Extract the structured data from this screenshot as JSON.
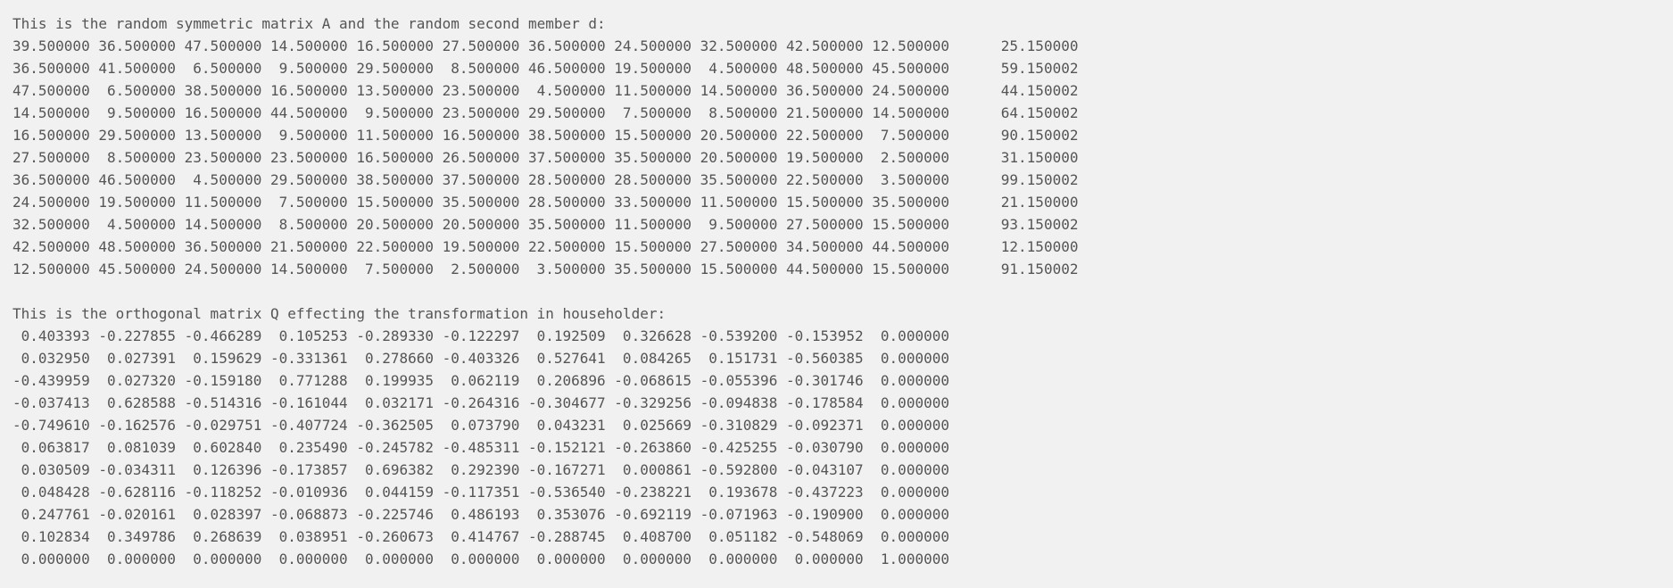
{
  "console": {
    "lines": [
      "This is the random symmetric matrix A and the random second member d:",
      "39.500000 36.500000 47.500000 14.500000 16.500000 27.500000 36.500000 24.500000 32.500000 42.500000 12.500000      25.150000",
      "36.500000 41.500000  6.500000  9.500000 29.500000  8.500000 46.500000 19.500000  4.500000 48.500000 45.500000      59.150002",
      "47.500000  6.500000 38.500000 16.500000 13.500000 23.500000  4.500000 11.500000 14.500000 36.500000 24.500000      44.150002",
      "14.500000  9.500000 16.500000 44.500000  9.500000 23.500000 29.500000  7.500000  8.500000 21.500000 14.500000      64.150002",
      "16.500000 29.500000 13.500000  9.500000 11.500000 16.500000 38.500000 15.500000 20.500000 22.500000  7.500000      90.150002",
      "27.500000  8.500000 23.500000 23.500000 16.500000 26.500000 37.500000 35.500000 20.500000 19.500000  2.500000      31.150000",
      "36.500000 46.500000  4.500000 29.500000 38.500000 37.500000 28.500000 28.500000 35.500000 22.500000  3.500000      99.150002",
      "24.500000 19.500000 11.500000  7.500000 15.500000 35.500000 28.500000 33.500000 11.500000 15.500000 35.500000      21.150000",
      "32.500000  4.500000 14.500000  8.500000 20.500000 20.500000 35.500000 11.500000  9.500000 27.500000 15.500000      93.150002",
      "42.500000 48.500000 36.500000 21.500000 22.500000 19.500000 22.500000 15.500000 27.500000 34.500000 44.500000      12.150000",
      "12.500000 45.500000 24.500000 14.500000  7.500000  2.500000  3.500000 35.500000 15.500000 44.500000 15.500000      91.150002",
      "",
      "This is the orthogonal matrix Q effecting the transformation in householder:",
      " 0.403393 -0.227855 -0.466289  0.105253 -0.289330 -0.122297  0.192509  0.326628 -0.539200 -0.153952  0.000000",
      " 0.032950  0.027391  0.159629 -0.331361  0.278660 -0.403326  0.527641  0.084265  0.151731 -0.560385  0.000000",
      "-0.439959  0.027320 -0.159180  0.771288  0.199935  0.062119  0.206896 -0.068615 -0.055396 -0.301746  0.000000",
      "-0.037413  0.628588 -0.514316 -0.161044  0.032171 -0.264316 -0.304677 -0.329256 -0.094838 -0.178584  0.000000",
      "-0.749610 -0.162576 -0.029751 -0.407724 -0.362505  0.073790  0.043231  0.025669 -0.310829 -0.092371  0.000000",
      " 0.063817  0.081039  0.602840  0.235490 -0.245782 -0.485311 -0.152121 -0.263860 -0.425255 -0.030790  0.000000",
      " 0.030509 -0.034311  0.126396 -0.173857  0.696382  0.292390 -0.167271  0.000861 -0.592800 -0.043107  0.000000",
      " 0.048428 -0.628116 -0.118252 -0.010936  0.044159 -0.117351 -0.536540 -0.238221  0.193678 -0.437223  0.000000",
      " 0.247761 -0.020161  0.028397 -0.068873 -0.225746  0.486193  0.353076 -0.692119 -0.071963 -0.190900  0.000000",
      " 0.102834  0.349786  0.268639  0.038951 -0.260673  0.414767 -0.288745  0.408700  0.051182 -0.548069  0.000000",
      " 0.000000  0.000000  0.000000  0.000000  0.000000  0.000000  0.000000  0.000000  0.000000  0.000000  1.000000"
    ]
  }
}
